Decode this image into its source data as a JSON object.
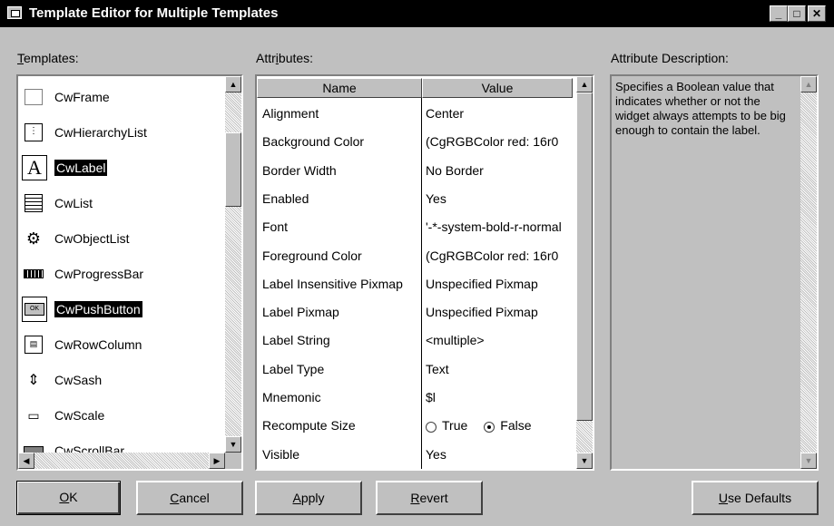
{
  "window": {
    "title": "Template Editor for Multiple Templates",
    "controls": [
      "minimize",
      "maximize",
      "close"
    ]
  },
  "templates": {
    "label_mnemonic": "T",
    "label_rest": "emplates:",
    "items": [
      {
        "name": "CwFrame",
        "icon": "frame-icon",
        "selected": false
      },
      {
        "name": "CwHierarchyList",
        "icon": "hierarchy-list-icon",
        "selected": false
      },
      {
        "name": "CwLabel",
        "icon": "label-a-icon",
        "selected": true
      },
      {
        "name": "CwList",
        "icon": "list-icon",
        "selected": false
      },
      {
        "name": "CwObjectList",
        "icon": "object-list-icon",
        "selected": false
      },
      {
        "name": "CwProgressBar",
        "icon": "progress-bar-icon",
        "selected": false
      },
      {
        "name": "CwPushButton",
        "icon": "push-button-icon",
        "selected": true
      },
      {
        "name": "CwRowColumn",
        "icon": "row-column-icon",
        "selected": false
      },
      {
        "name": "CwSash",
        "icon": "sash-icon",
        "selected": false
      },
      {
        "name": "CwScale",
        "icon": "scale-icon",
        "selected": false
      },
      {
        "name": "CwScrollBar",
        "icon": "scroll-bar-icon",
        "selected": false
      }
    ]
  },
  "attributes": {
    "label_pre": "Attr",
    "label_mnemonic": "i",
    "label_post": "butes:",
    "columns": [
      "Name",
      "Value"
    ],
    "rows": [
      {
        "name": "Alignment",
        "value": "Center"
      },
      {
        "name": "Background Color",
        "value": "(CgRGBColor red: 16r0"
      },
      {
        "name": "Border Width",
        "value": "No Border"
      },
      {
        "name": "Enabled",
        "value": "Yes"
      },
      {
        "name": "Font",
        "value": "'-*-system-bold-r-normal"
      },
      {
        "name": "Foreground Color",
        "value": "(CgRGBColor red: 16r0"
      },
      {
        "name": "Label Insensitive Pixmap",
        "value": "Unspecified Pixmap"
      },
      {
        "name": "Label Pixmap",
        "value": "Unspecified Pixmap"
      },
      {
        "name": "Label String",
        "value": "<multiple>"
      },
      {
        "name": "Label Type",
        "value": "Text"
      },
      {
        "name": "Mnemonic",
        "value": "$l"
      },
      {
        "name": "Recompute Size",
        "value": "",
        "radio": {
          "true_label": "True",
          "false_label": "False",
          "selected": "False"
        }
      },
      {
        "name": "Visible",
        "value": "Yes"
      }
    ]
  },
  "description": {
    "label": "Attribute Description:",
    "text": "Specifies a Boolean value that indicates whether or not the widget always attempts to be big enough to contain the label."
  },
  "buttons": {
    "ok": {
      "mnemonic": "O",
      "rest": "K"
    },
    "cancel": {
      "mnemonic": "C",
      "rest": "ancel"
    },
    "apply": {
      "mnemonic": "A",
      "rest": "pply"
    },
    "revert": {
      "mnemonic": "R",
      "rest": "evert"
    },
    "use_defaults": {
      "mnemonic": "U",
      "rest": "se Defaults"
    }
  }
}
